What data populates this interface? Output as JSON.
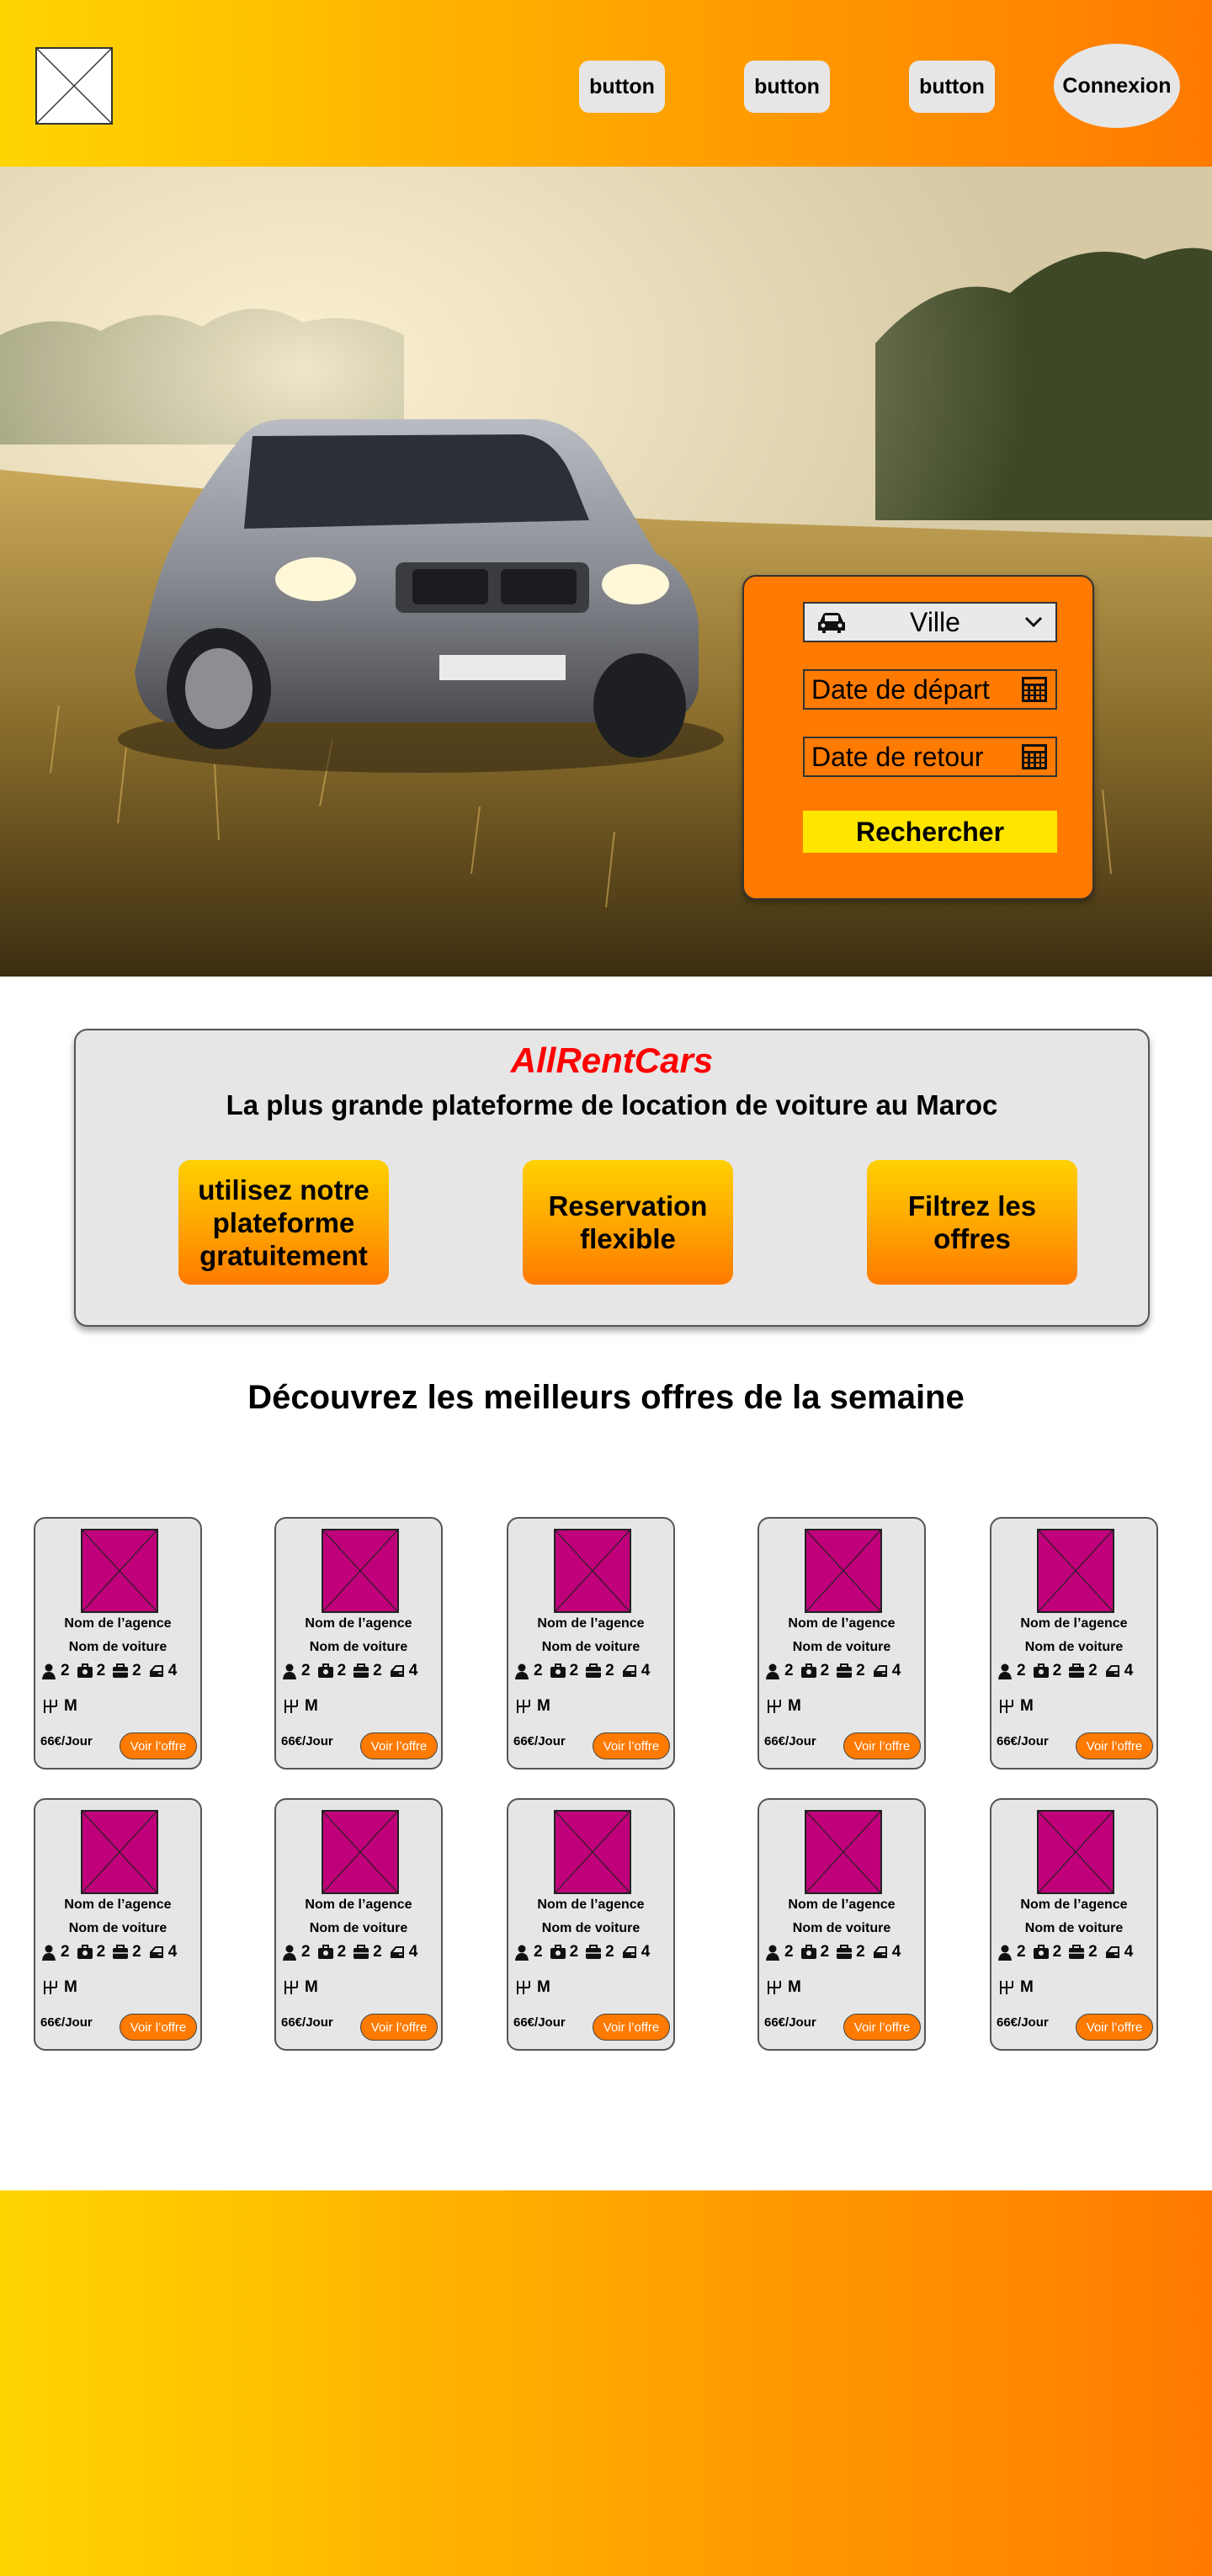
{
  "header": {
    "nav_buttons": [
      "button",
      "button",
      "button"
    ],
    "login_label": "Connexion",
    "gradient": [
      "#ffd500",
      "#ff7a00"
    ]
  },
  "search": {
    "city_label": "Ville",
    "departure_label": "Date de départ",
    "return_label": "Date de retour",
    "submit_label": "Rechercher",
    "panel_color": "#ff7a00",
    "button_color": "#ffe600"
  },
  "about": {
    "brand": "AllRentCars",
    "brand_color": "#ff0000",
    "tagline": "La plus grande plateforme de location de voiture au Maroc",
    "features": [
      "utilisez notre plateforme gratuitement",
      "Reservation flexible",
      "Filtrez les offres"
    ]
  },
  "offers": {
    "title": "Découvrez les meilleurs offres de la semaine",
    "cards": [
      {
        "agency": "Nom de l’agence",
        "car": "Nom de voiture",
        "seats": "2",
        "bags": "2",
        "luggage": "2",
        "doors": "4",
        "gearbox": "M",
        "price": "66€/Jour",
        "cta": "Voir l’offre"
      },
      {
        "agency": "Nom de l’agence",
        "car": "Nom de voiture",
        "seats": "2",
        "bags": "2",
        "luggage": "2",
        "doors": "4",
        "gearbox": "M",
        "price": "66€/Jour",
        "cta": "Voir l’offre"
      },
      {
        "agency": "Nom de l’agence",
        "car": "Nom de voiture",
        "seats": "2",
        "bags": "2",
        "luggage": "2",
        "doors": "4",
        "gearbox": "M",
        "price": "66€/Jour",
        "cta": "Voir l’offre"
      },
      {
        "agency": "Nom de l’agence",
        "car": "Nom de voiture",
        "seats": "2",
        "bags": "2",
        "luggage": "2",
        "doors": "4",
        "gearbox": "M",
        "price": "66€/Jour",
        "cta": "Voir l’offre"
      },
      {
        "agency": "Nom de l’agence",
        "car": "Nom de voiture",
        "seats": "2",
        "bags": "2",
        "luggage": "2",
        "doors": "4",
        "gearbox": "M",
        "price": "66€/Jour",
        "cta": "Voir l’offre"
      },
      {
        "agency": "Nom de l’agence",
        "car": "Nom de voiture",
        "seats": "2",
        "bags": "2",
        "luggage": "2",
        "doors": "4",
        "gearbox": "M",
        "price": "66€/Jour",
        "cta": "Voir l’offre"
      },
      {
        "agency": "Nom de l’agence",
        "car": "Nom de voiture",
        "seats": "2",
        "bags": "2",
        "luggage": "2",
        "doors": "4",
        "gearbox": "M",
        "price": "66€/Jour",
        "cta": "Voir l’offre"
      },
      {
        "agency": "Nom de l’agence",
        "car": "Nom de voiture",
        "seats": "2",
        "bags": "2",
        "luggage": "2",
        "doors": "4",
        "gearbox": "M",
        "price": "66€/Jour",
        "cta": "Voir l’offre"
      },
      {
        "agency": "Nom de l’agence",
        "car": "Nom de voiture",
        "seats": "2",
        "bags": "2",
        "luggage": "2",
        "doors": "4",
        "gearbox": "M",
        "price": "66€/Jour",
        "cta": "Voir l’offre"
      },
      {
        "agency": "Nom de l’agence",
        "car": "Nom de voiture",
        "seats": "2",
        "bags": "2",
        "luggage": "2",
        "doors": "4",
        "gearbox": "M",
        "price": "66€/Jour",
        "cta": "Voir l’offre"
      }
    ],
    "thumb_color": "#c0007a",
    "cta_color": "#ff7a00"
  },
  "icons": {
    "logo": "image-placeholder-icon",
    "city": "car-icon",
    "dropdown": "chevron-down-icon",
    "date": "calendar-icon",
    "seats": "person-icon",
    "bags": "bag-icon",
    "luggage": "suitcase-icon",
    "doors": "car-door-icon",
    "gearbox": "gearbox-icon"
  }
}
